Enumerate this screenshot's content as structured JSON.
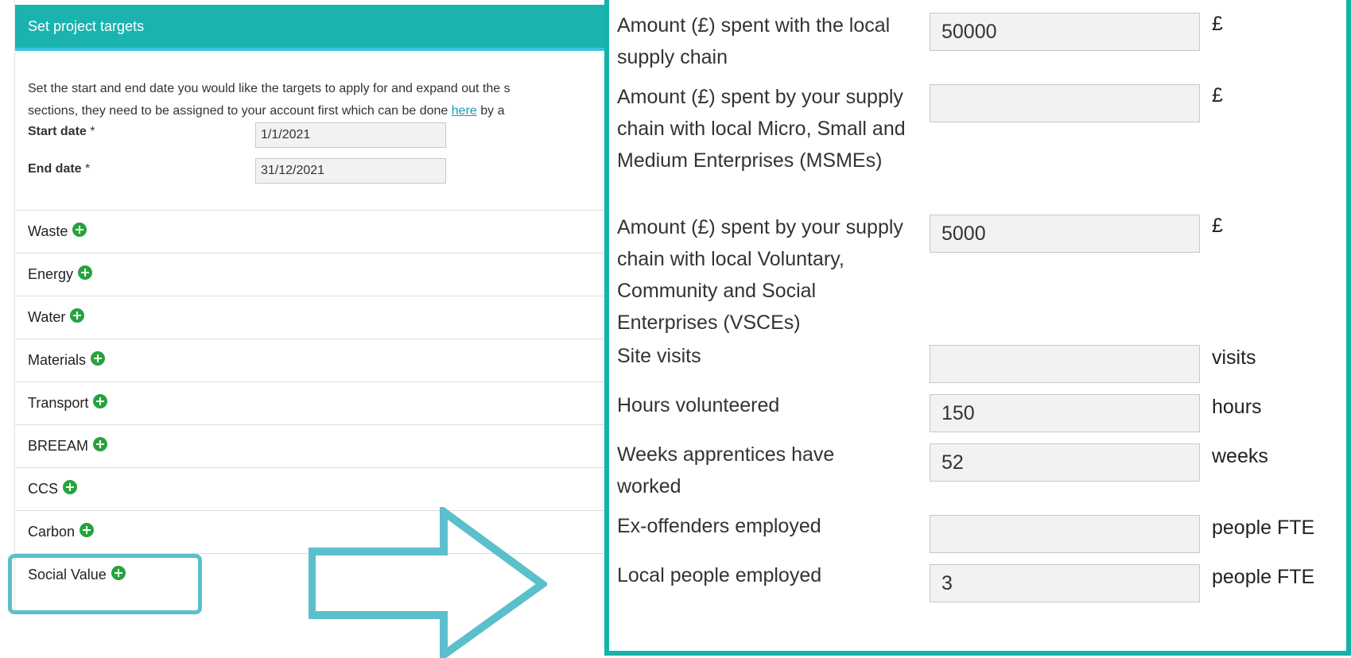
{
  "panel": {
    "title": "Set project targets",
    "intro_line1": "Set the start and end date you would like the targets to apply for and expand out the s",
    "intro_line2_before": "sections, they need to be assigned to your account first which can be done ",
    "intro_link": "here",
    "intro_line2_after": " by a",
    "start_date_label": "Start date",
    "start_date_value": "1/1/2021",
    "end_date_label": "End date",
    "end_date_value": "31/12/2021",
    "required_marker": "*",
    "sections": [
      {
        "label": "Waste"
      },
      {
        "label": "Energy"
      },
      {
        "label": "Water"
      },
      {
        "label": "Materials"
      },
      {
        "label": "Transport"
      },
      {
        "label": "BREEAM"
      },
      {
        "label": "CCS"
      },
      {
        "label": "Carbon"
      },
      {
        "label": "Social Value"
      }
    ]
  },
  "social_value": {
    "fields": [
      {
        "label": "Amount (£) spent with the local supply chain",
        "value": "50000",
        "unit": "£"
      },
      {
        "label": "Amount (£) spent by your supply chain with local Micro, Small and Medium Enterprises (MSMEs)",
        "value": "",
        "unit": "£"
      },
      {
        "label": "Amount (£) spent by your supply chain with local Voluntary, Community and Social Enterprises (VSCEs)",
        "value": "5000",
        "unit": "£"
      },
      {
        "label": "Site visits",
        "value": "",
        "unit": "visits"
      },
      {
        "label": "Hours volunteered",
        "value": "150",
        "unit": "hours"
      },
      {
        "label": "Weeks apprentices have worked",
        "value": "52",
        "unit": "weeks"
      },
      {
        "label": "Ex-offenders employed",
        "value": "",
        "unit": "people FTE"
      },
      {
        "label": "Local people employed",
        "value": "3",
        "unit": "people FTE"
      }
    ]
  },
  "colors": {
    "header": "#1ab3b0",
    "header_border": "#38c6d9",
    "plus_icon": "#26a33d",
    "highlight": "#5bbfcc",
    "overlay_border": "#14b3a8"
  }
}
